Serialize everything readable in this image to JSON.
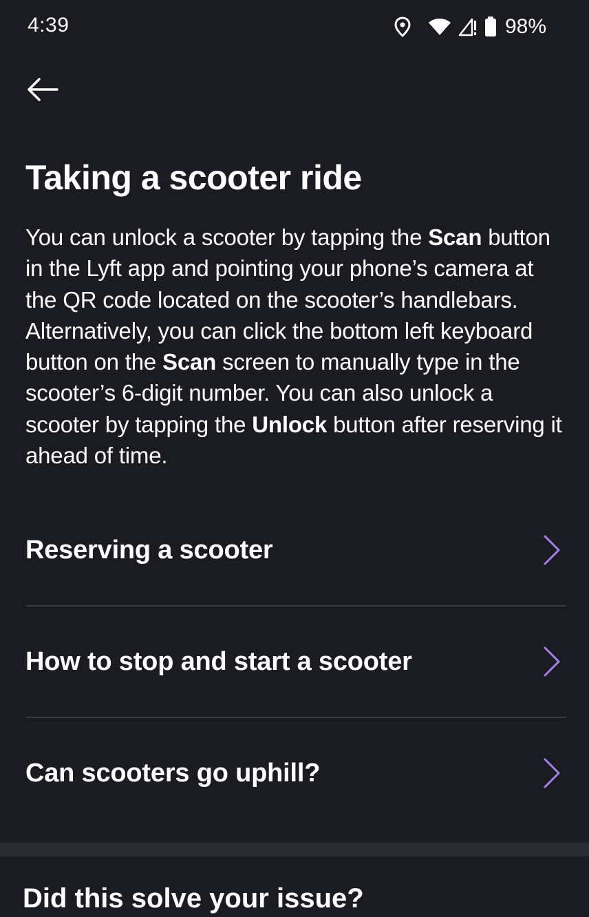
{
  "status_bar": {
    "time": "4:39",
    "battery_percent": "98%",
    "icons": [
      "location-icon",
      "wifi-icon",
      "signal-icon",
      "battery-icon"
    ]
  },
  "nav": {
    "back_icon": "arrow-left-icon"
  },
  "article": {
    "title": "Taking a scooter ride",
    "body_parts": {
      "p1": "You can unlock a scooter by tapping the ",
      "b1": "Scan",
      "p2": " button in the Lyft app and pointing your phone’s camera at the QR code located on the scooter’s handlebars. Alternatively, you can click the bottom left keyboard button on the ",
      "b2": "Scan",
      "p3": " screen to manually type in the scooter’s 6-digit number. You can also unlock a scooter by tapping the ",
      "b3": "Unlock",
      "p4": " button after reserving it ahead of time."
    }
  },
  "related_articles": [
    {
      "label": "Reserving a scooter"
    },
    {
      "label": "How to stop and start a scooter"
    },
    {
      "label": "Can scooters go uphill?"
    }
  ],
  "feedback": {
    "title": "Did this solve your issue?"
  },
  "colors": {
    "background": "#1b1b22",
    "text": "#ffffff",
    "accent_chevron": "#a97ef0",
    "divider": "#3a3a44",
    "section_separator": "#2a2a31"
  }
}
